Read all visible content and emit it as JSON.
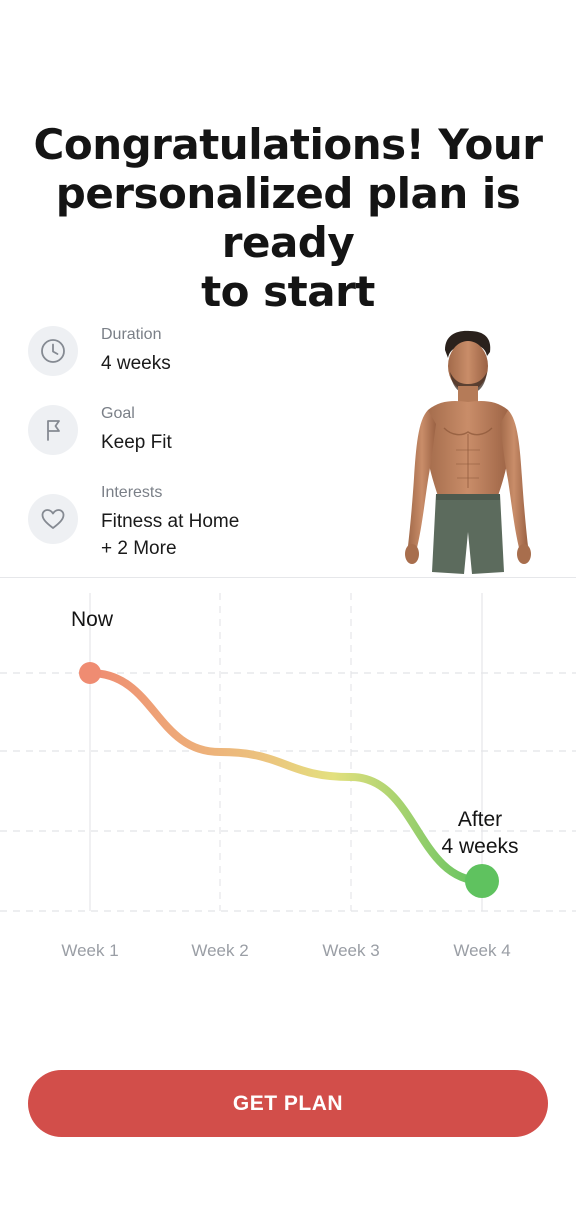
{
  "header": {
    "title_line1": "Congratulations! Your",
    "title_line2": "personalized plan is ready",
    "title_line3": "to start"
  },
  "plan_info": [
    {
      "icon": "clock-icon",
      "label": "Duration",
      "value": "4 weeks"
    },
    {
      "icon": "flag-icon",
      "label": "Goal",
      "value": "Keep Fit"
    },
    {
      "icon": "heart-icon",
      "label": "Interests",
      "value": "Fitness at Home",
      "value2": "+ 2 More"
    }
  ],
  "chart_data": {
    "type": "line",
    "categories": [
      "Week 1",
      "Week 2",
      "Week 3",
      "Week 4"
    ],
    "series": [
      {
        "values": [
          100,
          62,
          50,
          0
        ]
      }
    ],
    "annotations": {
      "start": "Now",
      "end_line1": "After",
      "end_line2": "4 weeks"
    },
    "colors": {
      "start": "#ef8c72",
      "mid": "#eedc80",
      "end": "#63c463"
    },
    "grid": true
  },
  "cta": {
    "label": "GET PLAN",
    "color": "#d24e4a"
  }
}
